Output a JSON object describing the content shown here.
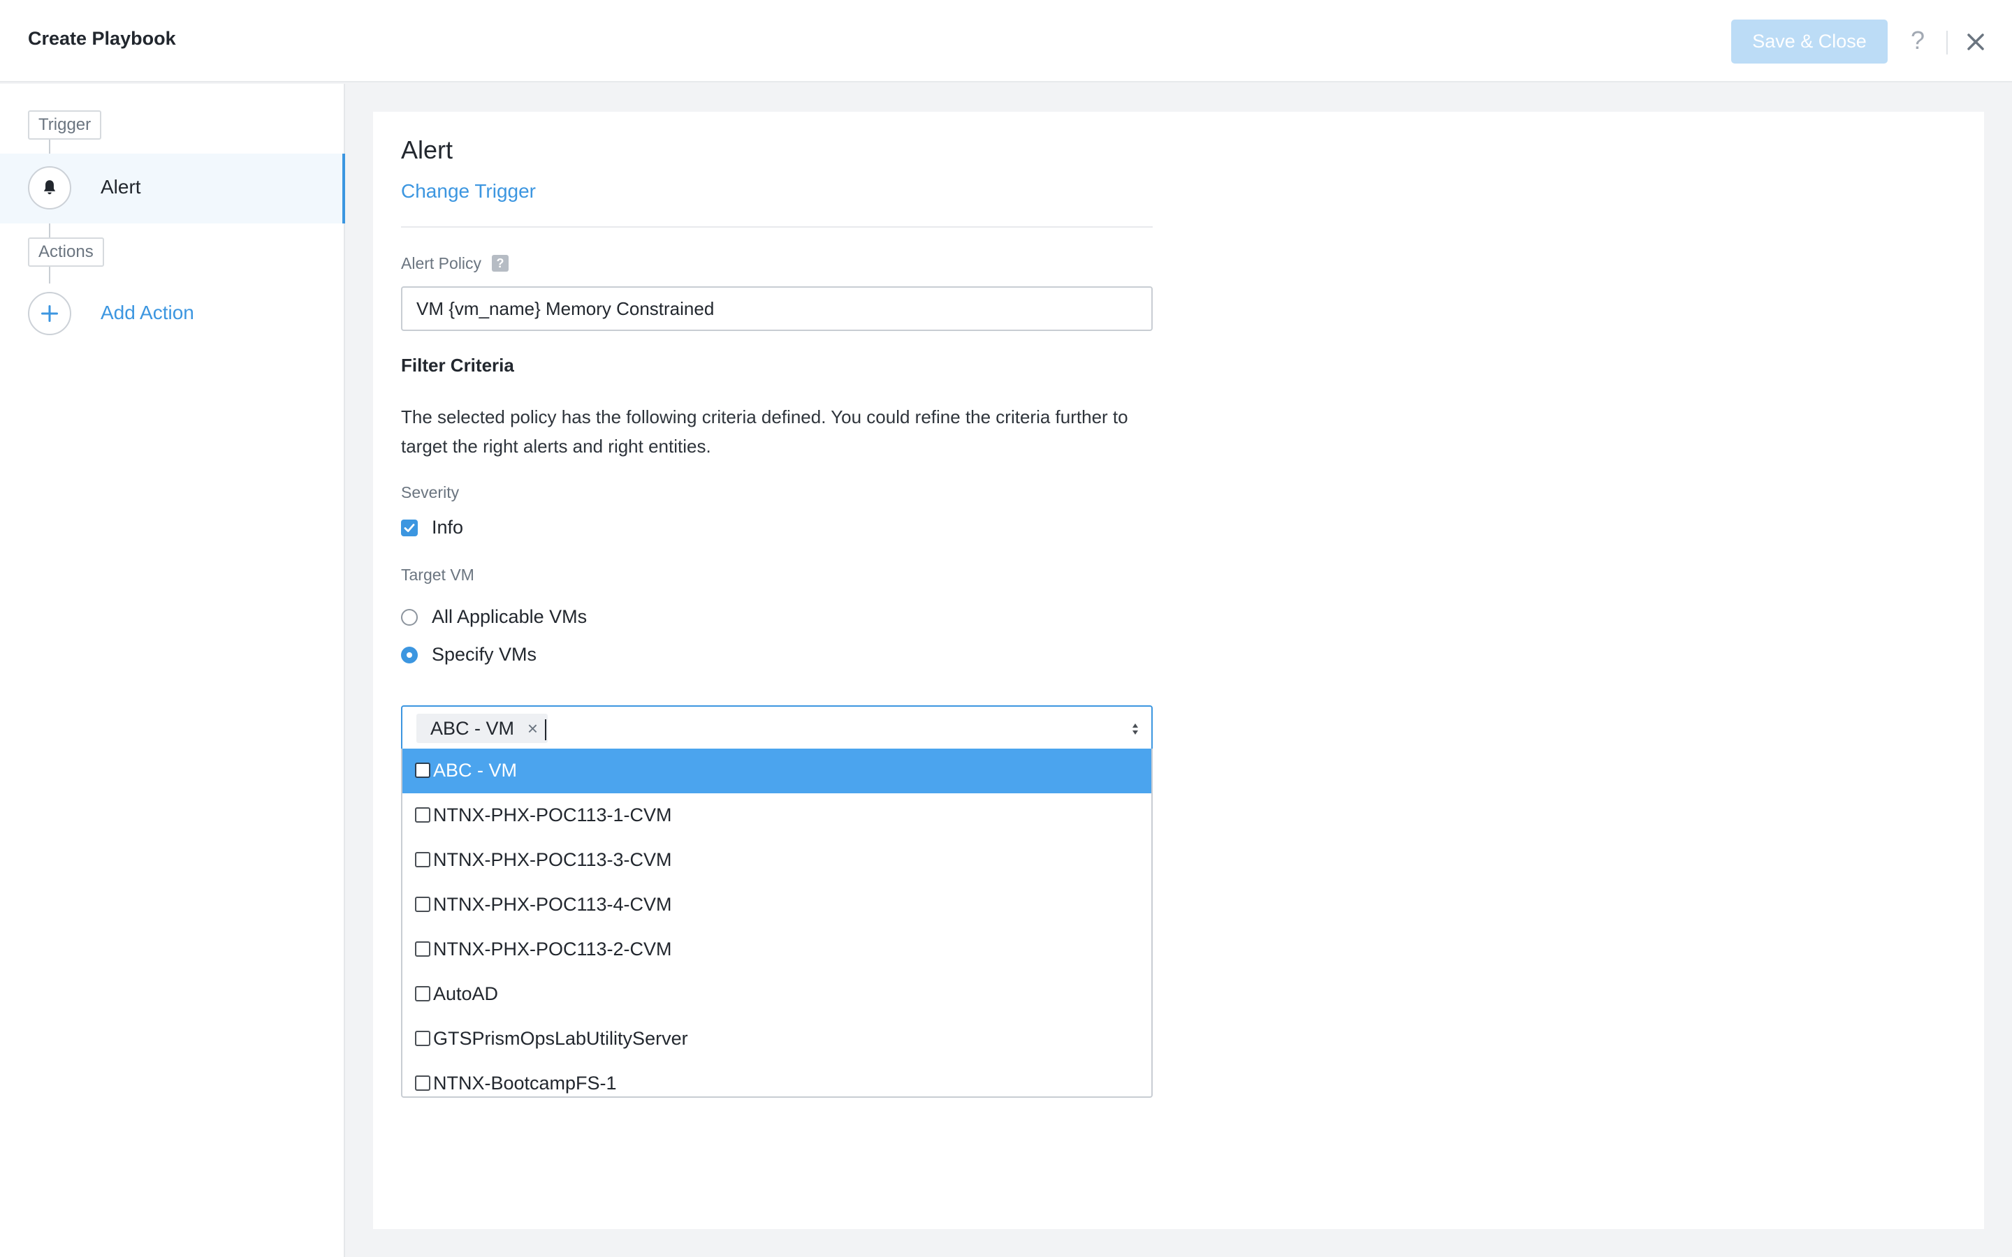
{
  "header": {
    "title": "Create Playbook",
    "save_label": "Save & Close",
    "help_label": "?"
  },
  "sidebar": {
    "trigger_tag": "Trigger",
    "trigger_label": "Alert",
    "actions_tag": "Actions",
    "add_action_label": "Add Action"
  },
  "main": {
    "title": "Alert",
    "change_trigger": "Change Trigger",
    "alert_policy_label": "Alert Policy",
    "alert_policy_help": "?",
    "alert_policy_value": "VM {vm_name} Memory Constrained",
    "filter_title": "Filter Criteria",
    "filter_desc": "The selected policy has the following criteria defined. You could refine the criteria further to target the right alerts and right entities.",
    "severity_label": "Severity",
    "severity_option": "Info",
    "target_label": "Target VM",
    "target_options": [
      "All Applicable VMs",
      "Specify VMs"
    ],
    "selected_target": "Specify VMs",
    "vm_select": {
      "chips": [
        "ABC - VM"
      ],
      "options": [
        "ABC - VM",
        "NTNX-PHX-POC113-1-CVM",
        "NTNX-PHX-POC113-3-CVM",
        "NTNX-PHX-POC113-4-CVM",
        "NTNX-PHX-POC113-2-CVM",
        "AutoAD",
        "GTSPrismOpsLabUtilityServer",
        "NTNX-BootcampFS-1"
      ],
      "highlighted": "ABC - VM"
    }
  },
  "colors": {
    "accent": "#3c96e0",
    "highlight": "#4ba4ee",
    "save_disabled": "#bcdcf6"
  },
  "icons": {
    "trigger": "bell-icon",
    "add": "plus-icon",
    "close": "close-icon",
    "chip_remove": "x-icon",
    "select_arrows": "sort-arrows-icon"
  }
}
